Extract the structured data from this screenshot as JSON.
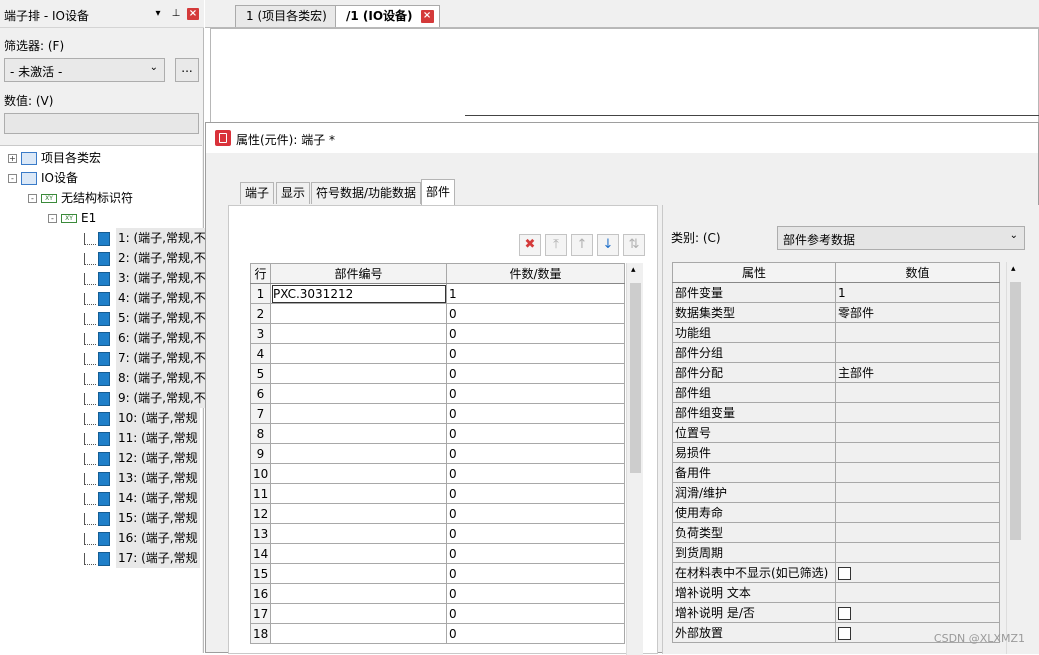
{
  "sidebar": {
    "title": "端子排 - IO设备",
    "filter_label": "筛选器: (F)",
    "filter_value": "- 未激活 -",
    "filter_more": "...",
    "value_label": "数值: (V)",
    "value_input": "",
    "tree": [
      {
        "label": "项目各类宏",
        "level": 0,
        "expander": "+",
        "icon": "page-icon"
      },
      {
        "label": "IO设备",
        "level": 0,
        "expander": "-",
        "icon": "page-icon"
      },
      {
        "label": "无结构标识符",
        "level": 1,
        "expander": "-",
        "icon": "xy-icon"
      },
      {
        "label": "E1",
        "level": 2,
        "expander": "-",
        "icon": "xy-icon"
      }
    ],
    "terminals": [
      "1: (端子,常规,不",
      "2: (端子,常规,不",
      "3: (端子,常规,不",
      "4: (端子,常规,不",
      "5: (端子,常规,不",
      "6: (端子,常规,不",
      "7: (端子,常规,不",
      "8: (端子,常规,不",
      "9: (端子,常规,不",
      "10: (端子,常规",
      "11: (端子,常规",
      "12: (端子,常规",
      "13: (端子,常规",
      "14: (端子,常规",
      "15: (端子,常规",
      "16: (端子,常规",
      "17: (端子,常规"
    ]
  },
  "tabs": [
    {
      "label": "1 (项目各类宏)"
    },
    {
      "label": "/1 (IO设备)"
    }
  ],
  "dialog": {
    "title": "属性(元件): 端子 *",
    "tabs": [
      "端子",
      "显示",
      "符号数据/功能数据",
      "部件"
    ],
    "active_tab": "部件",
    "parts_table": {
      "headers": [
        "行",
        "部件编号",
        "件数/数量"
      ],
      "rows": [
        [
          "1",
          "PXC.3031212",
          "1"
        ],
        [
          "2",
          "",
          "0"
        ],
        [
          "3",
          "",
          "0"
        ],
        [
          "4",
          "",
          "0"
        ],
        [
          "5",
          "",
          "0"
        ],
        [
          "6",
          "",
          "0"
        ],
        [
          "7",
          "",
          "0"
        ],
        [
          "8",
          "",
          "0"
        ],
        [
          "9",
          "",
          "0"
        ],
        [
          "10",
          "",
          "0"
        ],
        [
          "11",
          "",
          "0"
        ],
        [
          "12",
          "",
          "0"
        ],
        [
          "13",
          "",
          "0"
        ],
        [
          "14",
          "",
          "0"
        ],
        [
          "15",
          "",
          "0"
        ],
        [
          "16",
          "",
          "0"
        ],
        [
          "17",
          "",
          "0"
        ],
        [
          "18",
          "",
          "0"
        ]
      ]
    },
    "category_label": "类别: (C)",
    "category_value": "部件参考数据",
    "props_table": {
      "headers": [
        "属性",
        "数值"
      ],
      "rows": [
        {
          "prop": "部件变量",
          "value": "1"
        },
        {
          "prop": "数据集类型",
          "value": "零部件"
        },
        {
          "prop": "功能组",
          "value": ""
        },
        {
          "prop": "部件分组",
          "value": ""
        },
        {
          "prop": "部件分配",
          "value": "主部件"
        },
        {
          "prop": "部件组",
          "value": ""
        },
        {
          "prop": "部件组变量",
          "value": ""
        },
        {
          "prop": "位置号",
          "value": ""
        },
        {
          "prop": "易损件",
          "value": ""
        },
        {
          "prop": "备用件",
          "value": ""
        },
        {
          "prop": "润滑/维护",
          "value": ""
        },
        {
          "prop": "使用寿命",
          "value": ""
        },
        {
          "prop": "负荷类型",
          "value": ""
        },
        {
          "prop": "到货周期",
          "value": ""
        },
        {
          "prop": "在材料表中不显示(如已筛选)",
          "value": "",
          "checkbox": true
        },
        {
          "prop": "增补说明 文本",
          "value": ""
        },
        {
          "prop": "增补说明 是/否",
          "value": "",
          "checkbox": true
        },
        {
          "prop": "外部放置",
          "value": "",
          "checkbox": true
        }
      ]
    }
  },
  "watermark": "CSDN @XLXMZ1",
  "colors": {
    "accent": "#1f7fc9",
    "close": "#d43a3a",
    "delete": "#d9323a"
  }
}
